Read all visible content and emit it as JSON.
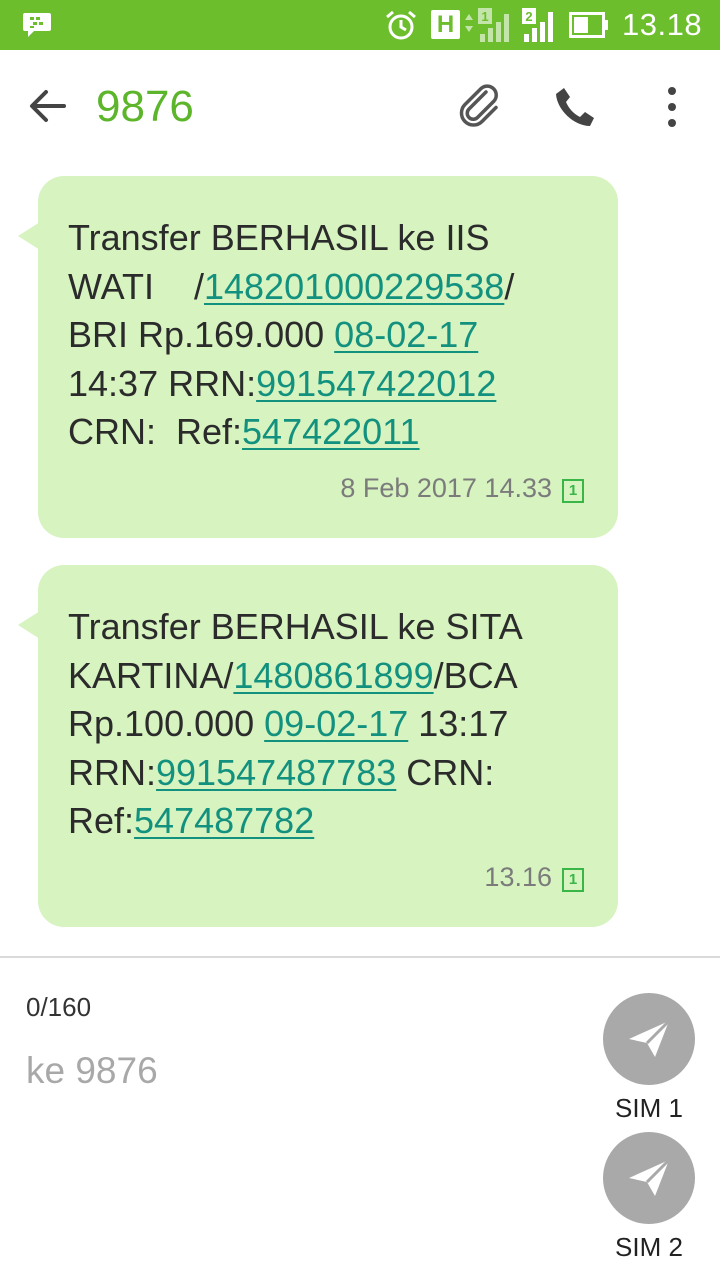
{
  "status_bar": {
    "time": "13.18",
    "network_type": "H",
    "sim1_badge": "1",
    "sim2_badge": "2",
    "color": "#6cbe2c"
  },
  "header": {
    "title": "9876",
    "back_icon": "arrow-left-icon",
    "attach_icon": "paperclip-icon",
    "call_icon": "phone-icon",
    "more_icon": "more-vert-icon"
  },
  "messages": [
    {
      "parts": [
        {
          "t": "Transfer BERHASIL ke IIS\nWATI    /"
        },
        {
          "t": "148201000229538",
          "link": true
        },
        {
          "t": "/\nBRI Rp.169.000 "
        },
        {
          "t": "08-02-17",
          "link": true
        },
        {
          "t": "\n14:37 RRN:"
        },
        {
          "t": "991547422012",
          "link": true
        },
        {
          "t": "\nCRN:  Ref:"
        },
        {
          "t": "547422011",
          "link": true
        }
      ],
      "timestamp": "8 Feb 2017 14.33",
      "sim": "1"
    },
    {
      "parts": [
        {
          "t": "Transfer BERHASIL ke SITA\nKARTINA/"
        },
        {
          "t": "1480861899",
          "link": true
        },
        {
          "t": "/BCA\nRp.100.000 "
        },
        {
          "t": "09-02-17",
          "link": true
        },
        {
          "t": " 13:17\nRRN:"
        },
        {
          "t": "991547487783",
          "link": true
        },
        {
          "t": " CRN:\nRef:"
        },
        {
          "t": "547487782",
          "link": true
        }
      ],
      "timestamp": "13.16",
      "sim": "1"
    }
  ],
  "compose": {
    "counter": "0/160",
    "placeholder": "ke 9876",
    "value": "",
    "send_sim1_label": "SIM 1",
    "send_sim2_label": "SIM 2",
    "send_icon": "send-icon"
  },
  "colors": {
    "accent": "#5cb52a",
    "bubble": "#d6f3c0",
    "link": "#13917f",
    "send_button": "#a9a9a9"
  }
}
